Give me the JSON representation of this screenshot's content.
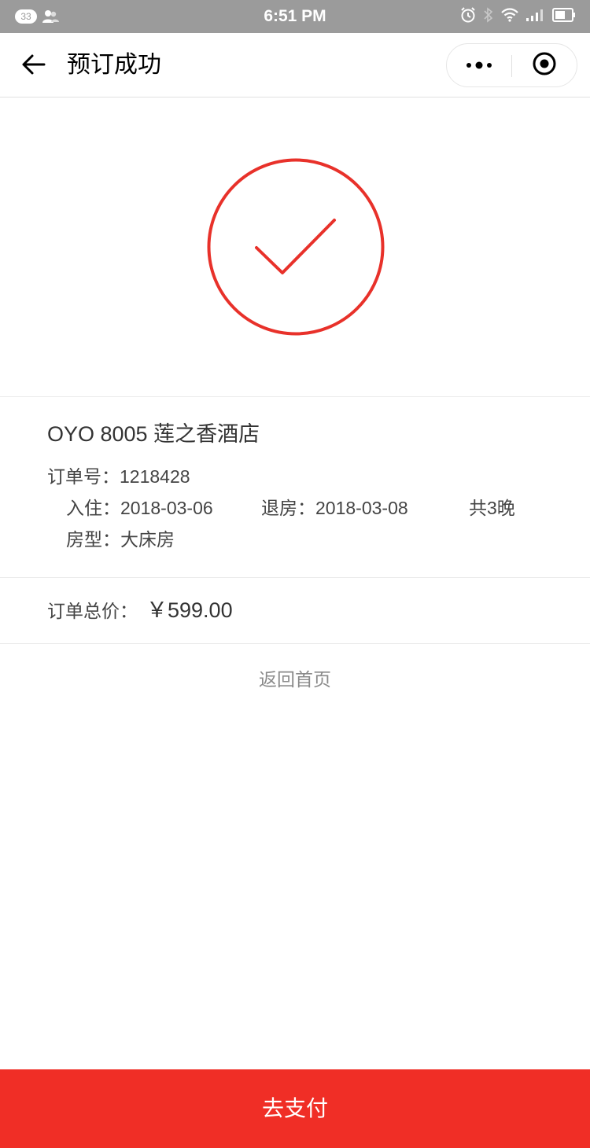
{
  "status_bar": {
    "notification_count": "33",
    "time": "6:51 PM",
    "icons": [
      "contacts-icon",
      "alarm-icon",
      "bluetooth-icon",
      "wifi-icon",
      "signal-icon",
      "battery-icon"
    ]
  },
  "nav": {
    "title": "预订成功",
    "back_icon": "arrow-left-icon",
    "more_icon": "more-dots-icon",
    "close_icon": "target-close-icon"
  },
  "success": {
    "icon": "check-circle-icon",
    "color": "#e8312a"
  },
  "order": {
    "hotel_name": "OYO 8005 莲之香酒店",
    "order_no_label": "订单号：",
    "order_no": "1218428",
    "checkin_label": "入住：",
    "checkin_date": "2018-03-06",
    "checkout_label": "退房：",
    "checkout_date": "2018-03-08",
    "nights": "共3晚",
    "room_type_label": "房型：",
    "room_type": "大床房",
    "total_label": "订单总价：",
    "total_price": "￥599.00"
  },
  "actions": {
    "back_home": "返回首页",
    "pay": "去支付",
    "pay_color": "#f02e26"
  }
}
